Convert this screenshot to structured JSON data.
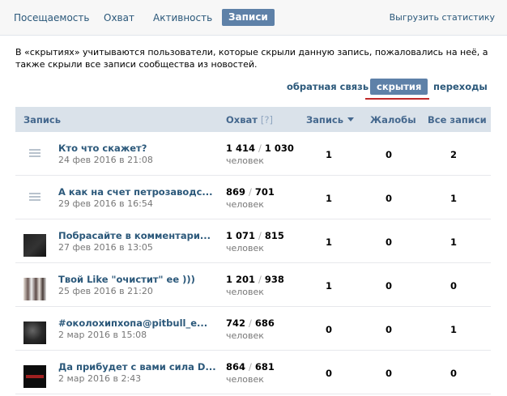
{
  "nav": {
    "tabs": [
      {
        "label": "Посещаемость"
      },
      {
        "label": "Охват"
      },
      {
        "label": "Активность"
      },
      {
        "label": "Записи",
        "active": true
      }
    ],
    "export_label": "Выгрузить статистику"
  },
  "note": "В «скрытиях» учитываются пользователи, которые скрыли данную запись, пожаловались на неё, а также скрыли все записи сообщества из новостей.",
  "subtabs": [
    {
      "label": "обратная связь"
    },
    {
      "label": "скрытия",
      "active": true
    },
    {
      "label": "переходы"
    }
  ],
  "table": {
    "headers": {
      "post": "Запись",
      "reach": "Охват",
      "reach_help": "[?]",
      "post_col": "Запись",
      "complaints": "Жалобы",
      "all_posts": "Все записи"
    },
    "unit": "человек",
    "rows": [
      {
        "title": "Кто что скажет?",
        "date": "24 фев 2016 в 21:08",
        "reach_total": "1 414",
        "reach_sub": "1 030",
        "post": "1",
        "complaints": "0",
        "all": "2",
        "thumb": "text-lines-icon"
      },
      {
        "title": "А как на счет петрозаводс...",
        "date": "29 фев 2016 в 16:54",
        "reach_total": "869",
        "reach_sub": "701",
        "post": "1",
        "complaints": "0",
        "all": "1",
        "thumb": "text-lines-icon"
      },
      {
        "title": "Побрасайте в комментари...",
        "date": "27 фев 2016 в 13:05",
        "reach_total": "1 071",
        "reach_sub": "815",
        "post": "1",
        "complaints": "0",
        "all": "1",
        "thumb": "photo"
      },
      {
        "title": "Твой Like \"очистит\" ее )))",
        "date": "25 фев 2016 в 21:20",
        "reach_total": "1 201",
        "reach_sub": "938",
        "post": "1",
        "complaints": "0",
        "all": "0",
        "thumb": "photo"
      },
      {
        "title": "#околохипхопа@pitbull_e...",
        "date": "2 мар 2016 в 15:08",
        "reach_total": "742",
        "reach_sub": "686",
        "post": "0",
        "complaints": "0",
        "all": "1",
        "thumb": "photo"
      },
      {
        "title": "Да прибудет с вами сила D...",
        "date": "2 мар 2016 в 2:43",
        "reach_total": "864",
        "reach_sub": "681",
        "post": "0",
        "complaints": "0",
        "all": "0",
        "thumb": "photo"
      }
    ]
  },
  "colors": {
    "link": "#2b587a",
    "accent": "#5e81a8",
    "header_bg": "#dae2ea",
    "underline": "#c02a2a"
  }
}
